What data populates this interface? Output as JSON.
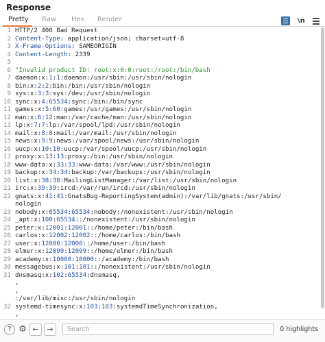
{
  "panel": {
    "title": "Response"
  },
  "tabs": [
    {
      "label": "Pretty",
      "active": true
    },
    {
      "label": "Raw",
      "active": false
    },
    {
      "label": "Hex",
      "active": false
    },
    {
      "label": "Render",
      "active": false
    }
  ],
  "toolbar": {
    "list_icon": "list-view-icon",
    "newline_label": "\\n",
    "menu_icon": "hamburger-menu-icon"
  },
  "response_lines": [
    {
      "n": "1",
      "parts": [
        {
          "t": "HTTP/2 400 Bad Request",
          "c": ""
        }
      ]
    },
    {
      "n": "2",
      "parts": [
        {
          "t": "Content-Type",
          "c": "kw"
        },
        {
          "t": ": application/json; charset=utf-8",
          "c": ""
        }
      ]
    },
    {
      "n": "3",
      "parts": [
        {
          "t": "X-Frame-Options",
          "c": "kw"
        },
        {
          "t": ": SAMEORIGIN",
          "c": ""
        }
      ]
    },
    {
      "n": "4",
      "parts": [
        {
          "t": "Content-Length",
          "c": "kw"
        },
        {
          "t": ": 2339",
          "c": ""
        }
      ]
    },
    {
      "n": "5",
      "parts": [
        {
          "t": "",
          "c": ""
        }
      ]
    },
    {
      "n": "6",
      "parts": [
        {
          "t": "\"Invalid product ID: root:x:0:0:root:/root:/bin/bash",
          "c": "str"
        }
      ]
    },
    {
      "n": "7",
      "parts": [
        {
          "t": "daemon:x:",
          "c": ""
        },
        {
          "t": "1",
          "c": "kw"
        },
        {
          "t": ":",
          "c": ""
        },
        {
          "t": "1",
          "c": "kw"
        },
        {
          "t": ":daemon:/usr/sbin:/usr/sbin/nologin",
          "c": ""
        }
      ]
    },
    {
      "n": "8",
      "parts": [
        {
          "t": "bin:x:",
          "c": ""
        },
        {
          "t": "2",
          "c": "kw"
        },
        {
          "t": ":",
          "c": ""
        },
        {
          "t": "2",
          "c": "kw"
        },
        {
          "t": ":bin:/bin:/usr/sbin/nologin",
          "c": ""
        }
      ]
    },
    {
      "n": "9",
      "parts": [
        {
          "t": "sys:x:",
          "c": ""
        },
        {
          "t": "3",
          "c": "kw"
        },
        {
          "t": ":",
          "c": ""
        },
        {
          "t": "3",
          "c": "kw"
        },
        {
          "t": ":sys:/dev:/usr/sbin/nologin",
          "c": ""
        }
      ]
    },
    {
      "n": "10",
      "parts": [
        {
          "t": "sync:x:",
          "c": ""
        },
        {
          "t": "4",
          "c": "kw"
        },
        {
          "t": ":",
          "c": ""
        },
        {
          "t": "65534",
          "c": "kw"
        },
        {
          "t": ":sync:/bin:/bin/sync",
          "c": ""
        }
      ]
    },
    {
      "n": "11",
      "parts": [
        {
          "t": "games:x:",
          "c": ""
        },
        {
          "t": "5",
          "c": "kw"
        },
        {
          "t": ":",
          "c": ""
        },
        {
          "t": "60",
          "c": "kw"
        },
        {
          "t": ":games:/usr/games:/usr/sbin/nologin",
          "c": ""
        }
      ]
    },
    {
      "n": "12",
      "parts": [
        {
          "t": "man:x:",
          "c": ""
        },
        {
          "t": "6",
          "c": "kw"
        },
        {
          "t": ":",
          "c": ""
        },
        {
          "t": "12",
          "c": "kw"
        },
        {
          "t": ":man:/var/cache/man:/usr/sbin/nologin",
          "c": ""
        }
      ]
    },
    {
      "n": "13",
      "parts": [
        {
          "t": "lp:x:",
          "c": ""
        },
        {
          "t": "7",
          "c": "kw"
        },
        {
          "t": ":",
          "c": ""
        },
        {
          "t": "7",
          "c": "kw"
        },
        {
          "t": ":lp:/var/spool/lpd:/usr/sbin/nologin",
          "c": ""
        }
      ]
    },
    {
      "n": "14",
      "parts": [
        {
          "t": "mail:x:",
          "c": ""
        },
        {
          "t": "8",
          "c": "kw"
        },
        {
          "t": ":",
          "c": ""
        },
        {
          "t": "8",
          "c": "kw"
        },
        {
          "t": ":mail:/var/mail:/usr/sbin/nologin",
          "c": ""
        }
      ]
    },
    {
      "n": "15",
      "parts": [
        {
          "t": "news:x:",
          "c": ""
        },
        {
          "t": "9",
          "c": "kw"
        },
        {
          "t": ":",
          "c": ""
        },
        {
          "t": "9",
          "c": "kw"
        },
        {
          "t": ":news:/var/spool/news:/usr/sbin/nologin",
          "c": ""
        }
      ]
    },
    {
      "n": "16",
      "parts": [
        {
          "t": "uucp:x:",
          "c": ""
        },
        {
          "t": "10",
          "c": "kw"
        },
        {
          "t": ":",
          "c": ""
        },
        {
          "t": "10",
          "c": "kw"
        },
        {
          "t": ":uucp:/var/spool/uucp:/usr/sbin/nologin",
          "c": ""
        }
      ]
    },
    {
      "n": "17",
      "parts": [
        {
          "t": "proxy:x:",
          "c": ""
        },
        {
          "t": "13",
          "c": "kw"
        },
        {
          "t": ":",
          "c": ""
        },
        {
          "t": "13",
          "c": "kw"
        },
        {
          "t": ":proxy:/bin:/usr/sbin/nologin",
          "c": ""
        }
      ]
    },
    {
      "n": "18",
      "parts": [
        {
          "t": "www-data:x:",
          "c": ""
        },
        {
          "t": "33",
          "c": "kw"
        },
        {
          "t": ":",
          "c": ""
        },
        {
          "t": "33",
          "c": "kw"
        },
        {
          "t": ":www-data:/var/www:/usr/sbin/nologin",
          "c": ""
        }
      ]
    },
    {
      "n": "19",
      "parts": [
        {
          "t": "backup:x:",
          "c": ""
        },
        {
          "t": "34",
          "c": "kw"
        },
        {
          "t": ":",
          "c": ""
        },
        {
          "t": "34",
          "c": "kw"
        },
        {
          "t": ":backup:/var/backups:/usr/sbin/nologin",
          "c": ""
        }
      ]
    },
    {
      "n": "20",
      "parts": [
        {
          "t": "list:x:",
          "c": ""
        },
        {
          "t": "38",
          "c": "kw"
        },
        {
          "t": ":",
          "c": ""
        },
        {
          "t": "38",
          "c": "kw"
        },
        {
          "t": ":MailingListManager:/var/list:/usr/sbin/nologin",
          "c": ""
        }
      ]
    },
    {
      "n": "21",
      "parts": [
        {
          "t": "irc:x:",
          "c": ""
        },
        {
          "t": "39",
          "c": "kw"
        },
        {
          "t": ":",
          "c": ""
        },
        {
          "t": "39",
          "c": "kw"
        },
        {
          "t": ":ircd:/var/run/ircd:/usr/sbin/nologin",
          "c": ""
        }
      ]
    },
    {
      "n": "22",
      "parts": [
        {
          "t": "gnats:x:",
          "c": ""
        },
        {
          "t": "41",
          "c": "kw"
        },
        {
          "t": ":",
          "c": ""
        },
        {
          "t": "41",
          "c": "kw"
        },
        {
          "t": ":GnatsBug-ReportingSystem(admin):/var/lib/gnats:/usr/sbin/",
          "c": ""
        }
      ]
    },
    {
      "n": "",
      "parts": [
        {
          "t": "nologin",
          "c": ""
        }
      ]
    },
    {
      "n": "23",
      "parts": [
        {
          "t": "nobody:x:",
          "c": ""
        },
        {
          "t": "65534",
          "c": "kw"
        },
        {
          "t": ":",
          "c": ""
        },
        {
          "t": "65534",
          "c": "kw"
        },
        {
          "t": ":nobody:/nonexistent:/usr/sbin/nologin",
          "c": ""
        }
      ]
    },
    {
      "n": "24",
      "parts": [
        {
          "t": "_apt:x:",
          "c": ""
        },
        {
          "t": "100",
          "c": "kw"
        },
        {
          "t": ":",
          "c": ""
        },
        {
          "t": "65534",
          "c": "kw"
        },
        {
          "t": "::/nonexistent:/usr/sbin/nologin",
          "c": ""
        }
      ]
    },
    {
      "n": "25",
      "parts": [
        {
          "t": "peter:x:",
          "c": ""
        },
        {
          "t": "12001",
          "c": "kw"
        },
        {
          "t": ":",
          "c": ""
        },
        {
          "t": "12001",
          "c": "kw"
        },
        {
          "t": "::/home/peter:/bin/bash",
          "c": ""
        }
      ]
    },
    {
      "n": "26",
      "parts": [
        {
          "t": "carlos:x:",
          "c": ""
        },
        {
          "t": "12002",
          "c": "kw"
        },
        {
          "t": ":",
          "c": ""
        },
        {
          "t": "12002",
          "c": "kw"
        },
        {
          "t": "::/home/carlos:/bin/bash",
          "c": ""
        }
      ]
    },
    {
      "n": "27",
      "parts": [
        {
          "t": "user:x:",
          "c": ""
        },
        {
          "t": "12000",
          "c": "kw"
        },
        {
          "t": ":",
          "c": ""
        },
        {
          "t": "12000",
          "c": "kw"
        },
        {
          "t": "::/home/user:/bin/bash",
          "c": ""
        }
      ]
    },
    {
      "n": "28",
      "parts": [
        {
          "t": "elmer:x:",
          "c": ""
        },
        {
          "t": "12099",
          "c": "kw"
        },
        {
          "t": ":",
          "c": ""
        },
        {
          "t": "12099",
          "c": "kw"
        },
        {
          "t": "::/home/elmer:/bin/bash",
          "c": ""
        }
      ]
    },
    {
      "n": "29",
      "parts": [
        {
          "t": "academy:x:",
          "c": ""
        },
        {
          "t": "10000",
          "c": "kw"
        },
        {
          "t": ":",
          "c": ""
        },
        {
          "t": "10000",
          "c": "kw"
        },
        {
          "t": "::/academy:/bin/bash",
          "c": ""
        }
      ]
    },
    {
      "n": "30",
      "parts": [
        {
          "t": "messagebus:x:",
          "c": ""
        },
        {
          "t": "101",
          "c": "kw"
        },
        {
          "t": ":",
          "c": ""
        },
        {
          "t": "101",
          "c": "kw"
        },
        {
          "t": "::/nonexistent:/usr/sbin/nologin",
          "c": ""
        }
      ]
    },
    {
      "n": "31",
      "parts": [
        {
          "t": "dnsmasq:x:",
          "c": ""
        },
        {
          "t": "102",
          "c": "kw"
        },
        {
          "t": ":",
          "c": ""
        },
        {
          "t": "65534",
          "c": "kw"
        },
        {
          "t": ":dnsmasq,",
          "c": ""
        }
      ]
    },
    {
      "n": "",
      "parts": [
        {
          "t": ",",
          "c": ""
        }
      ]
    },
    {
      "n": "",
      "parts": [
        {
          "t": ",",
          "c": ""
        }
      ]
    },
    {
      "n": "",
      "parts": [
        {
          "t": ":/var/lib/misc:/usr/sbin/nologin",
          "c": ""
        }
      ]
    },
    {
      "n": "32",
      "parts": [
        {
          "t": "systemd-timesync:x:",
          "c": ""
        },
        {
          "t": "103",
          "c": "kw"
        },
        {
          "t": ":",
          "c": ""
        },
        {
          "t": "103",
          "c": "kw"
        },
        {
          "t": ":systemdTimeSynchronization,",
          "c": ""
        }
      ]
    },
    {
      "n": "",
      "parts": [
        {
          "t": ",",
          "c": ""
        }
      ]
    }
  ],
  "footer": {
    "help_label": "?",
    "settings_label": "⚙",
    "back_label": "←",
    "forward_label": "→",
    "search_placeholder": "Search",
    "search_value": "",
    "highlights_text": "0 highlights"
  },
  "colors": {
    "accent_tab_underline": "#e8762c",
    "header_name": "#1f4fa0",
    "string_value": "#2e8b2e"
  }
}
